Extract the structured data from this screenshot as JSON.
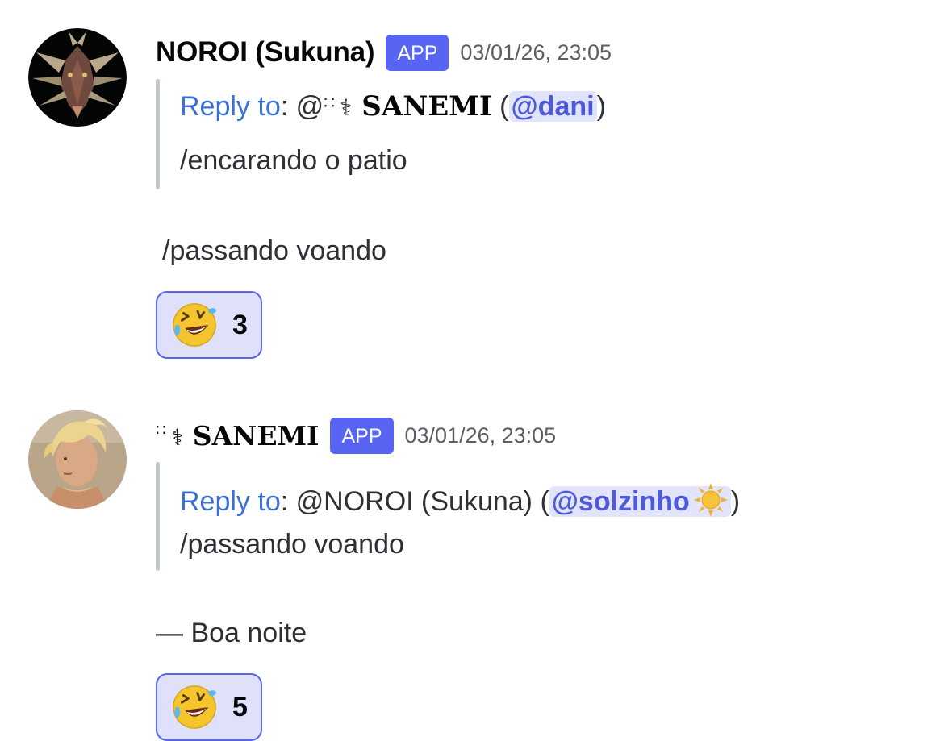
{
  "messages": [
    {
      "author": "NOROI (Sukuna)",
      "badge": "APP",
      "timestamp": "03/01/26, 23:05",
      "avatar_icon": "dragon-head-avatar",
      "reply": {
        "label": "Reply to",
        "prefix": ": @",
        "dots": "∷ ",
        "anchor": "⚕",
        "name": " SANEMI",
        "open_paren": " (",
        "mention": "@dani",
        "close_paren": ")",
        "text": "/encarando o patio"
      },
      "body": "/passando voando",
      "reaction": {
        "emoji": "rolling-on-floor-laughing-icon",
        "count": "3"
      }
    },
    {
      "author_dots": "∷ ",
      "author_anchor": "⚕",
      "author_name": " SANEMI",
      "badge": "APP",
      "timestamp": "03/01/26, 23:05",
      "avatar_icon": "blond-person-avatar",
      "reply": {
        "label": "Reply to",
        "prefix": ": @NOROI (Sukuna) (",
        "mention": "@solzinho",
        "mention_emoji": "sun-icon",
        "close_paren": ")",
        "text": " /passando voando"
      },
      "body": "— Boa noite",
      "reaction": {
        "emoji": "rolling-on-floor-laughing-icon",
        "count": "5"
      }
    }
  ],
  "colors": {
    "badge": "#5865f2",
    "reply_link": "#3a70d6",
    "mention_bg": "#e1e4fb",
    "mention_text": "#4d5ad9",
    "reaction_bg": "#dfe1fb",
    "reaction_border": "#5865f2",
    "quote_bar": "#c4c9ce"
  }
}
